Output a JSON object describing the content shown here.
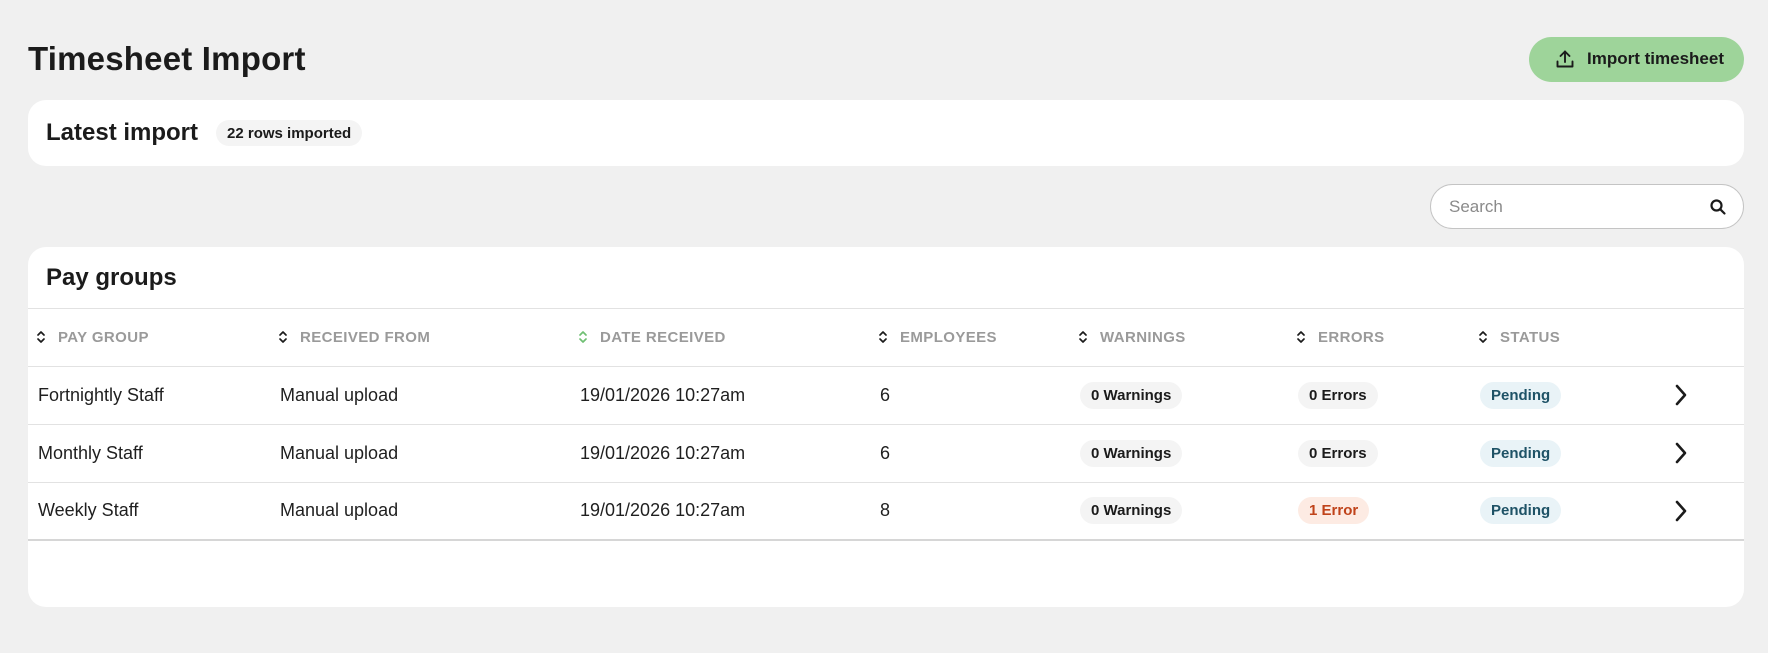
{
  "page": {
    "title": "Timesheet Import"
  },
  "actions": {
    "import_label": "Import timesheet",
    "import_icon": "upload-icon"
  },
  "latest_import": {
    "title": "Latest import",
    "rows_badge": "22 rows imported"
  },
  "search": {
    "placeholder": "Search",
    "value": "",
    "icon": "search-icon"
  },
  "pay_groups": {
    "title": "Pay groups",
    "columns": [
      "PAY GROUP",
      "RECEIVED FROM",
      "DATE RECEIVED",
      "EMPLOYEES",
      "WARNINGS",
      "ERRORS",
      "STATUS"
    ],
    "active_sort_column": "DATE RECEIVED",
    "rows": [
      {
        "pay_group": "Fortnightly Staff",
        "received_from": "Manual upload",
        "date_received": "19/01/2026 10:27am",
        "employees": "6",
        "warnings": "0 Warnings",
        "errors": "0 Errors",
        "errors_type": "neutral",
        "status": "Pending"
      },
      {
        "pay_group": "Monthly Staff",
        "received_from": "Manual upload",
        "date_received": "19/01/2026 10:27am",
        "employees": "6",
        "warnings": "0 Warnings",
        "errors": "0 Errors",
        "errors_type": "neutral",
        "status": "Pending"
      },
      {
        "pay_group": "Weekly Staff",
        "received_from": "Manual upload",
        "date_received": "19/01/2026 10:27am",
        "employees": "8",
        "warnings": "0 Warnings",
        "errors": "1 Error",
        "errors_type": "error",
        "status": "Pending"
      }
    ]
  },
  "colors": {
    "background": "#f0f0f0",
    "card": "#ffffff",
    "primary_button": "#9ed49a",
    "error_pill_bg": "#fdebe3",
    "error_pill_text": "#c0431a",
    "status_pill_bg": "#e9f3f7",
    "status_pill_text": "#1e5266",
    "sort_active": "#6fbf73"
  }
}
